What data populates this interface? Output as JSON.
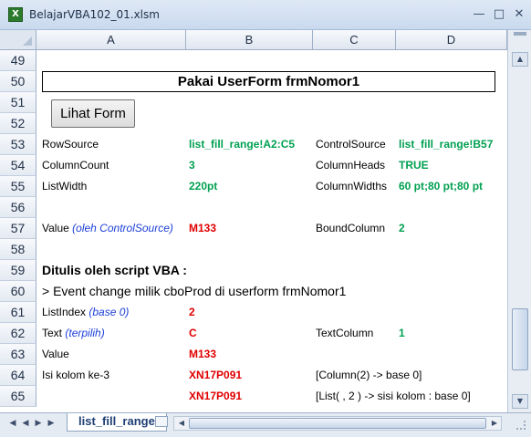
{
  "window": {
    "title": "BelajarVBA102_01.xlsm",
    "icon": "excel-icon"
  },
  "columns": [
    "A",
    "B",
    "C",
    "D"
  ],
  "rows": [
    "49",
    "50",
    "51",
    "52",
    "53",
    "54",
    "55",
    "56",
    "57",
    "58",
    "59",
    "60",
    "61",
    "62",
    "63",
    "64",
    "65"
  ],
  "sheet": {
    "title": "Pakai UserForm frmNomor1",
    "button_label": "Lihat Form",
    "r53": {
      "a": "RowSource",
      "b": "list_fill_range!A2:C5",
      "c": "ControlSource",
      "d": "list_fill_range!B57"
    },
    "r54": {
      "a": "ColumnCount",
      "b": "3",
      "c": "ColumnHeads",
      "d": "TRUE"
    },
    "r55": {
      "a": "ListWidth",
      "b": "220pt",
      "c": "ColumnWidths",
      "d": "60 pt;80 pt;80 pt"
    },
    "r57": {
      "a": "Value",
      "a_note": "(oleh ControlSource)",
      "b": "M133",
      "c": "BoundColumn",
      "d": "2"
    },
    "r59": {
      "a": "Ditulis oleh script VBA :"
    },
    "r60": {
      "a": "> Event change milik cboProd di userform frmNomor1"
    },
    "r61": {
      "a": "ListIndex",
      "a_note": "(base 0)",
      "b": "2"
    },
    "r62": {
      "a": "Text",
      "a_note": "(terpilih)",
      "b": "C",
      "c": "TextColumn",
      "d": "1"
    },
    "r63": {
      "a": "Value",
      "b": "M133"
    },
    "r64": {
      "a": "Isi kolom ke-3",
      "b": "XN17P091",
      "c": "[Column(2) -> base 0]"
    },
    "r65": {
      "b": "XN17P091",
      "c": "[List( , 2 ) -> sisi kolom : base 0]"
    }
  },
  "tabs": {
    "active": "list_fill_range"
  },
  "colors": {
    "green": "#00a050",
    "red": "#e00000",
    "blue": "#1c3fd6"
  }
}
